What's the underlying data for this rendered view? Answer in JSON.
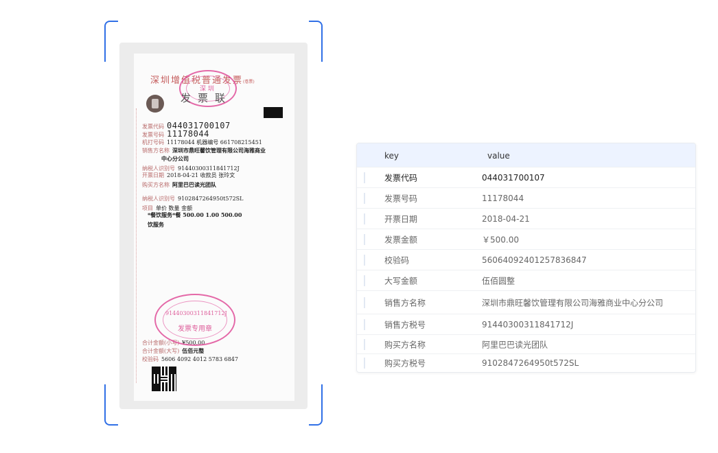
{
  "receipt": {
    "title": "深圳增值税普通发票",
    "title_note": "(卷票)",
    "subtitle": "发票联",
    "stamp_top_text": "深 圳",
    "stamp_bottom_code": "91440300311841712J",
    "stamp_bottom_label": "发票专用章",
    "fields": [
      {
        "label": "发票代码",
        "value": "044031700107",
        "style": "big"
      },
      {
        "label": "发票号码",
        "value": "11178044",
        "style": "big"
      },
      {
        "label": "机打号码",
        "value": "11178044  机器编号  661708215451",
        "style": ""
      },
      {
        "label": "销售方名称",
        "value": "深圳市鼎旺馨饮管理有限公司海雅商业",
        "style": "bold"
      },
      {
        "label": "",
        "value": "中心分公司",
        "style": "bold"
      },
      {
        "label": "纳税人识别号",
        "value": "91440300311841712J",
        "style": ""
      },
      {
        "label": "开票日期",
        "value": "2018-04-21   收款员  张玲文",
        "style": ""
      },
      {
        "label": "购买方名称",
        "value": "阿里巴巴读光团队",
        "style": "bold"
      },
      {
        "label": "纳税人识别号",
        "value": "9102847264950t572SL",
        "style": ""
      },
      {
        "label": "项目",
        "value": "单价      数量      金额",
        "style": ""
      },
      {
        "label": "",
        "value": "*餐饮服务*餐  500.00   1.00   500.00",
        "style": "bold"
      },
      {
        "label": "",
        "value": "饮服务",
        "style": "bold"
      },
      {
        "label": "合计金额(小写)",
        "value": "¥500.00",
        "style": ""
      },
      {
        "label": "合计金额(大写)",
        "value": "伍佰元整",
        "style": "bold"
      },
      {
        "label": "校验码",
        "value": "5606 4092 4012 5783 6847",
        "style": ""
      }
    ]
  },
  "table": {
    "header_key": "key",
    "header_value": "value",
    "rows": [
      {
        "key": "发票代码",
        "value": "044031700107"
      },
      {
        "key": "发票号码",
        "value": "11178044"
      },
      {
        "key": "开票日期",
        "value": "2018-04-21"
      },
      {
        "key": "发票金额",
        "value": "￥500.00"
      },
      {
        "key": "校验码",
        "value": "56064092401257836847"
      },
      {
        "key": "大写金额",
        "value": "伍佰圆整"
      },
      {
        "key": "销售方名称",
        "value": "深圳市鼎旺馨饮管理有限公司海雅商业中心分公司"
      },
      {
        "key": "销售方税号",
        "value": "91440300311841712J"
      },
      {
        "key": "购买方名称",
        "value": "阿里巴巴读光团队"
      },
      {
        "key": "购买方税号",
        "value": "9102847264950t572SL"
      }
    ]
  },
  "colors": {
    "accent": "#2f6fe6",
    "header_bg": "#edf3ff",
    "stamp": "#e0509a"
  }
}
